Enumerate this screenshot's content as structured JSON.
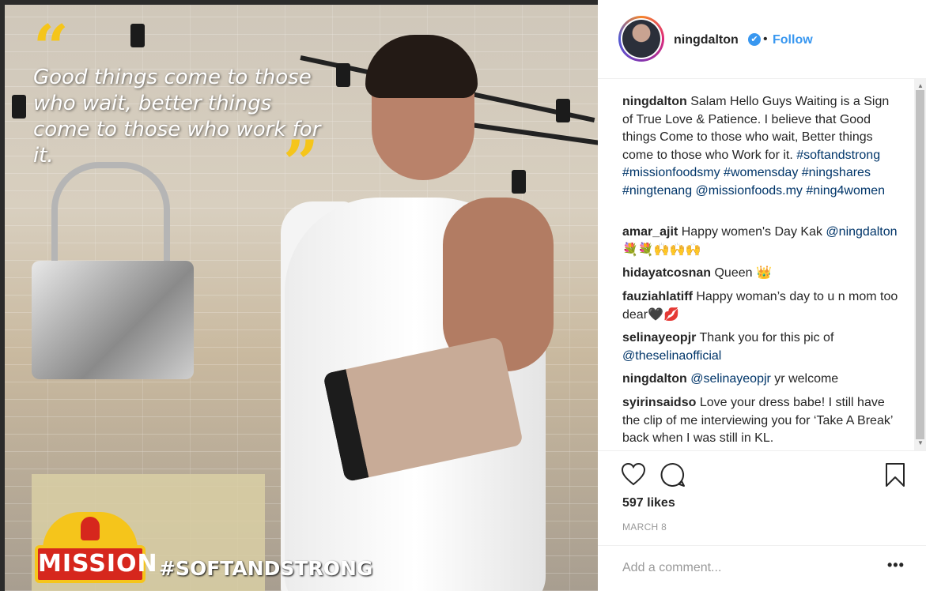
{
  "photo": {
    "quote": "Good things come to those who wait, better things come to those who work for it.",
    "open_mark": "“",
    "close_mark": "”",
    "brand": "MISSION",
    "hashtag": "#SOFTANDSTRONG"
  },
  "post": {
    "username": "ningdalton",
    "verified": "✔",
    "separator": "•",
    "follow_label": "Follow",
    "likes": "597 likes",
    "date": "MARCH 8",
    "comment_placeholder": "Add a comment...",
    "more_label": "•••"
  },
  "caption": {
    "user": "ningdalton",
    "text": "Salam Hello Guys Waiting is a Sign of True Love & Patience. I believe that Good things Come to those who wait, Better things come to those who Work for it.",
    "tags": "#softandstrong #missionfoodsmy #womensday #ningshares #ningtenang @missionfoods.my #ning4women"
  },
  "comments": [
    {
      "user": "amar_ajit",
      "text": "Happy women's Day Kak",
      "tag": "@ningdalton",
      "suffix": "💐💐🙌🙌🙌"
    },
    {
      "user": "hidayatcosnan",
      "text": "Queen 👑",
      "tag": "",
      "suffix": ""
    },
    {
      "user": "fauziahlatiff",
      "text": "Happy woman’s day to u n mom too dear🖤💋",
      "tag": "",
      "suffix": ""
    },
    {
      "user": "selinayeopjr",
      "text": "Thank you for this pic of",
      "tag": "@theselinaofficial",
      "suffix": ""
    },
    {
      "user": "ningdalton",
      "text": "yr welcome",
      "tag": "@selinayeopjr",
      "suffix": ""
    },
    {
      "user": "syirinsaidso",
      "text": "Love your dress babe! I still have the clip of me interviewing you for ‘Take A Break’ back when I was still in KL.",
      "tag": "",
      "suffix": ""
    }
  ],
  "colors": {
    "link": "#003569",
    "follow": "#3897f0",
    "accent": "#f5c51b",
    "brand_red": "#d6271d"
  },
  "icons": [
    "heart-icon",
    "comment-icon",
    "bookmark-icon",
    "verified-badge-icon"
  ]
}
